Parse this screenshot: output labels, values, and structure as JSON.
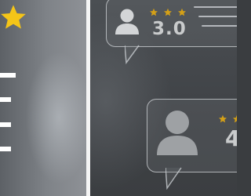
{
  "cards": [
    {
      "rating": "3.0",
      "stars": 3
    },
    {
      "rating": "4",
      "stars": 2
    }
  ],
  "colors": {
    "star": "#f5c518",
    "small_star": "#d4a017"
  }
}
